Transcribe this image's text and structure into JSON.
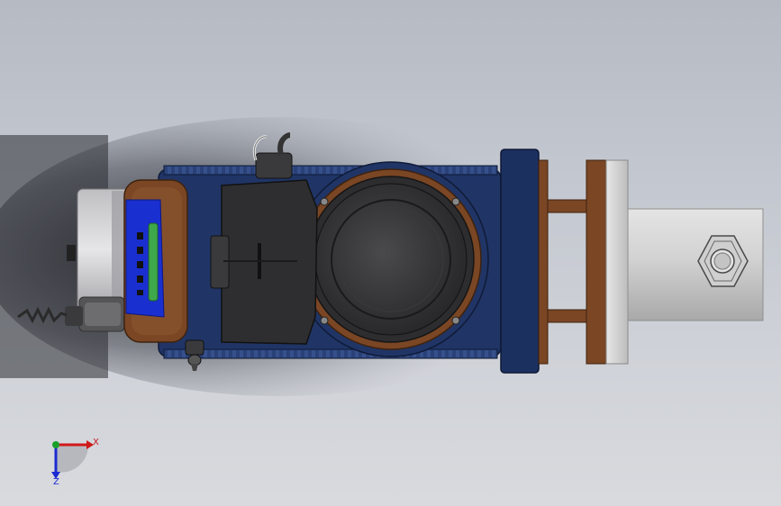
{
  "viewport": {
    "background_top": "#b6bac3",
    "background_bottom": "#d8dade"
  },
  "colors": {
    "housing_navy": "#203566",
    "blue_panel": "#1a2fd0",
    "green_strip": "#3ea84a",
    "copper": "#7a4624",
    "black_body": "#2e2e30",
    "cylinder_gray": "#cfcfcf"
  },
  "triad": {
    "x_label": "X",
    "z_label": "Z",
    "x_color": "#d01818",
    "y_color": "#1aa02a",
    "z_color": "#1a2ad2"
  }
}
